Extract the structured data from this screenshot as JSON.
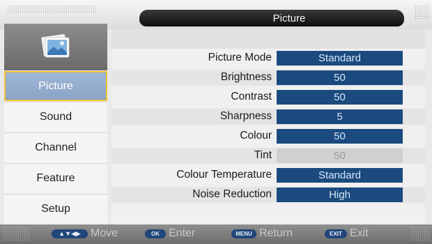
{
  "header": {
    "title": "Picture"
  },
  "sidebar": {
    "icon": "picture-icon",
    "items": [
      {
        "label": "Picture",
        "active": true
      },
      {
        "label": "Sound"
      },
      {
        "label": "Channel"
      },
      {
        "label": "Feature"
      },
      {
        "label": "Setup"
      }
    ]
  },
  "settings": [
    {
      "label": "Picture Mode",
      "value": "Standard"
    },
    {
      "label": "Brightness",
      "value": "50"
    },
    {
      "label": "Contrast",
      "value": "50"
    },
    {
      "label": "Sharpness",
      "value": "5"
    },
    {
      "label": "Colour",
      "value": "50"
    },
    {
      "label": "Tint",
      "value": "50",
      "disabled": true
    },
    {
      "label": "Colour Temperature",
      "value": "Standard"
    },
    {
      "label": "Noise Reduction",
      "value": "High"
    }
  ],
  "footer": {
    "move": {
      "key": "arrows-icon",
      "label": "Move"
    },
    "enter": {
      "key": "OK",
      "label": "Enter"
    },
    "return": {
      "key": "MENU",
      "label": "Return"
    },
    "exit": {
      "key": "EXIT",
      "label": "Exit"
    }
  },
  "colors": {
    "value_bg": "#1a4a7e",
    "active_nav": "#9fb6d6",
    "highlight_border": "#f1c232"
  }
}
